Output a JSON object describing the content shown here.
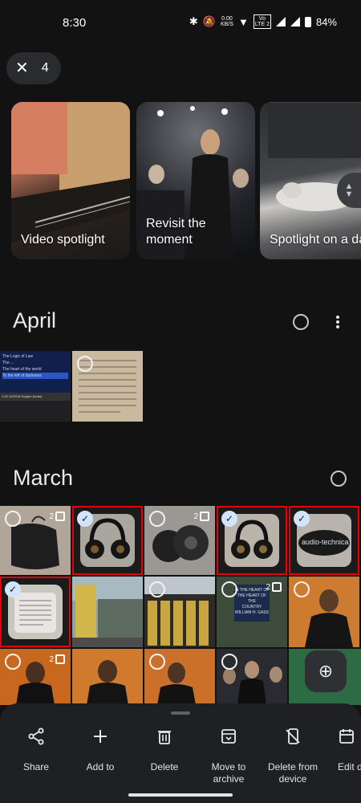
{
  "status_bar": {
    "time": "8:30",
    "net_speed": "0.00",
    "net_unit": "KB/S",
    "sim_top": "Vo",
    "sim_bottom": "LTE 2",
    "battery": "84%"
  },
  "selection": {
    "close_icon": "close-icon",
    "count": "4"
  },
  "memories": [
    {
      "label": "Video spotlight"
    },
    {
      "label": "Revisit the moment"
    },
    {
      "label": "Spotlight on a day"
    }
  ],
  "sections": [
    {
      "title": "April"
    },
    {
      "title": "March"
    }
  ],
  "stacks": {
    "count_a": "2",
    "count_b": "2",
    "count_c": "2",
    "count_d": "2"
  },
  "tile_text": {
    "tv_lines": [
      "The Logic of Law",
      "The ...",
      "The heart of the world",
      "To the left of darkness"
    ],
    "tv_bar": "1:00   10/2018   English (India)",
    "brand": "audio-technica",
    "sign_a": "IN THE HEART OF",
    "sign_b": "THE HEART OF THE",
    "sign_c": "COUNTRY",
    "sign_d": "WILLIAM H. GASS"
  },
  "actions": [
    {
      "icon": "share-icon",
      "label": "Share"
    },
    {
      "icon": "add-icon",
      "label": "Add to"
    },
    {
      "icon": "trash-icon",
      "label": "Delete"
    },
    {
      "icon": "archive-icon",
      "label": "Move to archive"
    },
    {
      "icon": "phone-off-icon",
      "label": "Delete from device"
    },
    {
      "icon": "calendar-icon",
      "label": "Edit date and time"
    }
  ],
  "colors": {
    "background": "#121212",
    "selection_outline": "#e8000b",
    "check_fill": "#d2e3fc",
    "sheet": "#1f2023"
  }
}
